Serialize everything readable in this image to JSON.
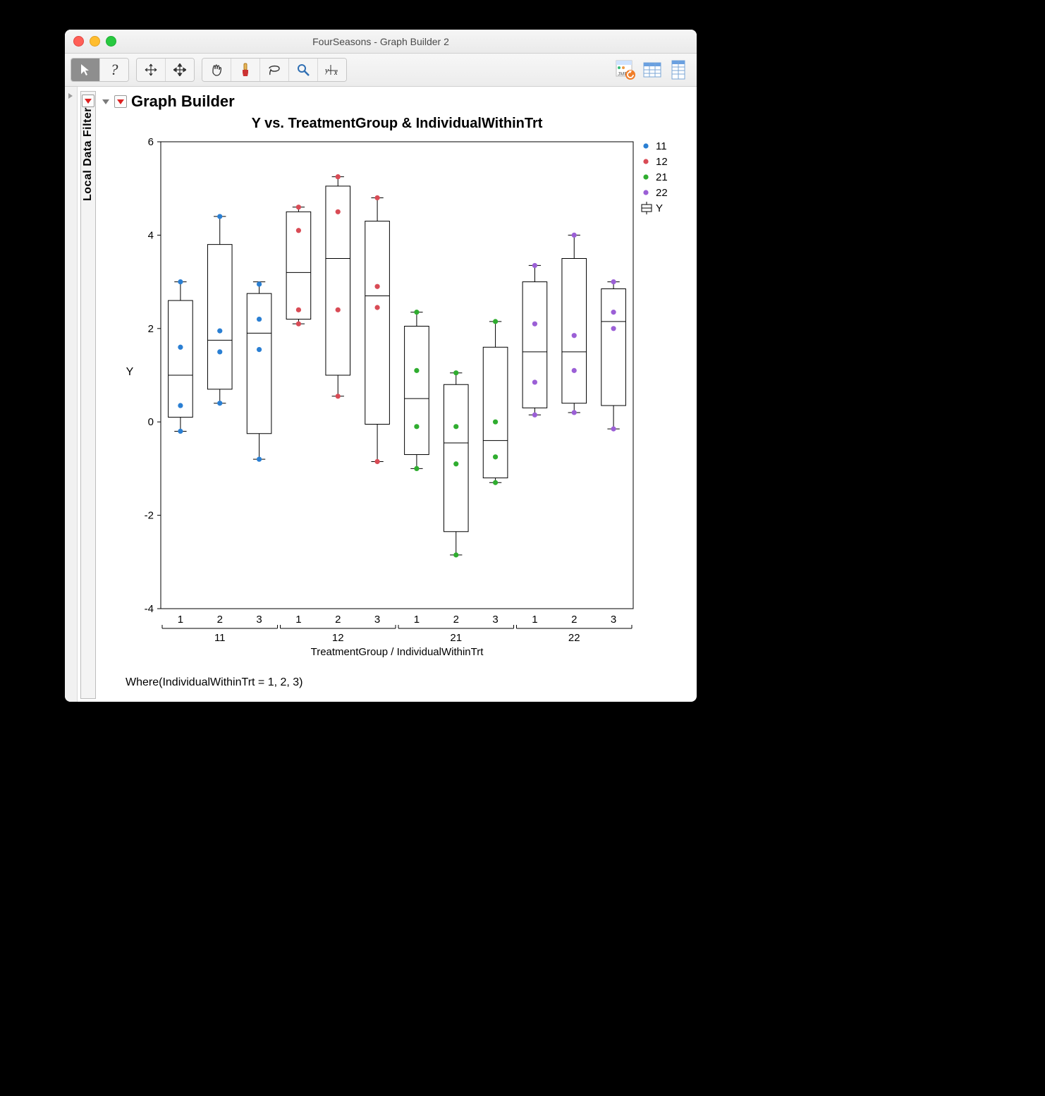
{
  "window": {
    "title": "FourSeasons - Graph Builder 2"
  },
  "outline": {
    "graph_builder": "Graph Builder"
  },
  "sidebar": {
    "local_data_filter": "Local Data Filter"
  },
  "footer": {
    "where_clause": "Where(IndividualWithinTrt = 1, 2, 3)"
  },
  "legend": {
    "items": [
      {
        "label": "11",
        "color": "#2a7fd3",
        "type": "point"
      },
      {
        "label": "12",
        "color": "#d94b55",
        "type": "point"
      },
      {
        "label": "21",
        "color": "#2fad2f",
        "type": "point"
      },
      {
        "label": "22",
        "color": "#9b5fd6",
        "type": "point"
      },
      {
        "label": "Y",
        "color": "#000000",
        "type": "box"
      }
    ]
  },
  "chart_data": {
    "type": "box",
    "title": "Y vs. TreatmentGroup & IndividualWithinTrt",
    "ylabel": "Y",
    "xlabel": "TreatmentGroup / IndividualWithinTrt",
    "ylim": [
      -4,
      6
    ],
    "yticks": [
      -4,
      -2,
      0,
      2,
      4,
      6
    ],
    "groups": [
      "11",
      "12",
      "21",
      "22"
    ],
    "sub_levels": [
      "1",
      "2",
      "3"
    ],
    "categories": [
      "11-1",
      "11-2",
      "11-3",
      "12-1",
      "12-2",
      "12-3",
      "21-1",
      "21-2",
      "21-3",
      "22-1",
      "22-2",
      "22-3"
    ],
    "group_colors": {
      "11": "#2a7fd3",
      "12": "#d94b55",
      "21": "#2fad2f",
      "22": "#9b5fd6"
    },
    "boxes": [
      {
        "cat": "11-1",
        "min": -0.2,
        "q1": 0.1,
        "median": 1.0,
        "q3": 2.6,
        "max": 3.0
      },
      {
        "cat": "11-2",
        "min": 0.4,
        "q1": 0.7,
        "median": 1.75,
        "q3": 3.8,
        "max": 4.4
      },
      {
        "cat": "11-3",
        "min": -0.8,
        "q1": -0.25,
        "median": 1.9,
        "q3": 2.75,
        "max": 3.0
      },
      {
        "cat": "12-1",
        "min": 2.1,
        "q1": 2.2,
        "median": 3.2,
        "q3": 4.5,
        "max": 4.6
      },
      {
        "cat": "12-2",
        "min": 0.55,
        "q1": 1.0,
        "median": 3.5,
        "q3": 5.05,
        "max": 5.25
      },
      {
        "cat": "12-3",
        "min": -0.85,
        "q1": -0.05,
        "median": 2.7,
        "q3": 4.3,
        "max": 4.8
      },
      {
        "cat": "21-1",
        "min": -1.0,
        "q1": -0.7,
        "median": 0.5,
        "q3": 2.05,
        "max": 2.35
      },
      {
        "cat": "21-2",
        "min": -2.85,
        "q1": -2.35,
        "median": -0.45,
        "q3": 0.8,
        "max": 1.05
      },
      {
        "cat": "21-3",
        "min": -1.3,
        "q1": -1.2,
        "median": -0.4,
        "q3": 1.6,
        "max": 2.15
      },
      {
        "cat": "22-1",
        "min": 0.15,
        "q1": 0.3,
        "median": 1.5,
        "q3": 3.0,
        "max": 3.35
      },
      {
        "cat": "22-2",
        "min": 0.2,
        "q1": 0.4,
        "median": 1.5,
        "q3": 3.5,
        "max": 4.0
      },
      {
        "cat": "22-3",
        "min": -0.15,
        "q1": 0.35,
        "median": 2.15,
        "q3": 2.85,
        "max": 3.0
      }
    ],
    "points": [
      {
        "cat": "11-1",
        "y": -0.2
      },
      {
        "cat": "11-1",
        "y": 0.35
      },
      {
        "cat": "11-1",
        "y": 1.6
      },
      {
        "cat": "11-1",
        "y": 3.0
      },
      {
        "cat": "11-2",
        "y": 0.4
      },
      {
        "cat": "11-2",
        "y": 1.5
      },
      {
        "cat": "11-2",
        "y": 1.95
      },
      {
        "cat": "11-2",
        "y": 4.4
      },
      {
        "cat": "11-3",
        "y": -0.8
      },
      {
        "cat": "11-3",
        "y": 1.55
      },
      {
        "cat": "11-3",
        "y": 2.2
      },
      {
        "cat": "11-3",
        "y": 2.95
      },
      {
        "cat": "12-1",
        "y": 2.1
      },
      {
        "cat": "12-1",
        "y": 2.4
      },
      {
        "cat": "12-1",
        "y": 4.1
      },
      {
        "cat": "12-1",
        "y": 4.6
      },
      {
        "cat": "12-2",
        "y": 0.55
      },
      {
        "cat": "12-2",
        "y": 2.4
      },
      {
        "cat": "12-2",
        "y": 4.5
      },
      {
        "cat": "12-2",
        "y": 5.25
      },
      {
        "cat": "12-3",
        "y": -0.85
      },
      {
        "cat": "12-3",
        "y": 2.45
      },
      {
        "cat": "12-3",
        "y": 2.9
      },
      {
        "cat": "12-3",
        "y": 4.8
      },
      {
        "cat": "21-1",
        "y": -1.0
      },
      {
        "cat": "21-1",
        "y": -0.1
      },
      {
        "cat": "21-1",
        "y": 1.1
      },
      {
        "cat": "21-1",
        "y": 2.35
      },
      {
        "cat": "21-2",
        "y": -2.85
      },
      {
        "cat": "21-2",
        "y": -0.9
      },
      {
        "cat": "21-2",
        "y": -0.1
      },
      {
        "cat": "21-2",
        "y": 1.05
      },
      {
        "cat": "21-3",
        "y": -1.3
      },
      {
        "cat": "21-3",
        "y": -0.75
      },
      {
        "cat": "21-3",
        "y": 0.0
      },
      {
        "cat": "21-3",
        "y": 2.15
      },
      {
        "cat": "22-1",
        "y": 0.15
      },
      {
        "cat": "22-1",
        "y": 0.85
      },
      {
        "cat": "22-1",
        "y": 2.1
      },
      {
        "cat": "22-1",
        "y": 3.35
      },
      {
        "cat": "22-2",
        "y": 0.2
      },
      {
        "cat": "22-2",
        "y": 1.1
      },
      {
        "cat": "22-2",
        "y": 1.85
      },
      {
        "cat": "22-2",
        "y": 4.0
      },
      {
        "cat": "22-3",
        "y": -0.15
      },
      {
        "cat": "22-3",
        "y": 2.0
      },
      {
        "cat": "22-3",
        "y": 2.35
      },
      {
        "cat": "22-3",
        "y": 3.0
      }
    ]
  }
}
